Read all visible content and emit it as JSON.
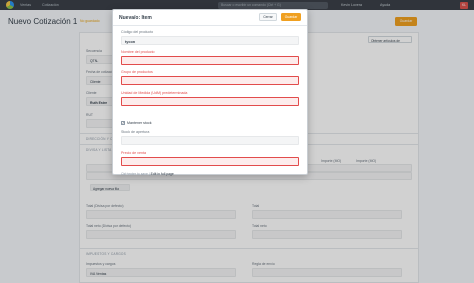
{
  "navbar": {
    "crumbs": [
      "Ventas",
      "Cotización"
    ],
    "search_placeholder": "Buscar o escribir un comando (Ctrl + G)",
    "user": "Kevin Lovera",
    "help": "Ayuda",
    "avatar_text": "KL"
  },
  "page": {
    "title": "Nuevo Cotización 1",
    "status": "No guardado",
    "save_label": "Guardar"
  },
  "form": {
    "select_right": "Obtener artículos de",
    "series_label": "Secuencia",
    "series_value": "QTN-",
    "date_label": "Fecha de cotización",
    "date_value": "Cliente",
    "customer_label": "Cliente",
    "customer_value": "Ruth Estre",
    "rut_label": "RUT",
    "sections": [
      "DIRECCIÓN Y CONTACTO",
      "DIVISA Y LISTA DE PRECIOS",
      "DESCUENTO Y MARGEN"
    ],
    "col_rate_mo": "Importe (MO)",
    "col_amount_mo": "Importe (MO)",
    "col_importe": "Importe (MO)",
    "add_row": "Agregar nueva fila",
    "total_mo_label": "Total (Divisa por defecto)",
    "total_label": "Total",
    "total_net_label": "Total neto (Divisa por defecto)",
    "total_net_right": "Total neto",
    "bottom_section": "IMPUESTOS Y CARGOS",
    "tax_label": "Impuestos y cargos",
    "tax_value": "IVA Ventas",
    "rule_label": "Regla de envío"
  },
  "modal": {
    "title": "Nueva/o: Item",
    "close_label": "Cerrar",
    "save_label": "Guardar",
    "fields": [
      {
        "label": "Código del producto",
        "value": "tycon",
        "required": false
      },
      {
        "label": "Nombre del producto",
        "value": "",
        "required": true
      },
      {
        "label": "Grupo de productos",
        "value": "",
        "required": true
      },
      {
        "label": "Unidad de Medida (UdM) predeterminada",
        "value": "",
        "required": true
      }
    ],
    "maintain_stock_label": "Mantener stock",
    "maintain_stock_checked": true,
    "opening_stock_label": "Stock de apertura",
    "rate_label": "Precio de venta",
    "hint_prefix": "Ctrl+enter to save | ",
    "hint_link": "Edit in full page"
  }
}
